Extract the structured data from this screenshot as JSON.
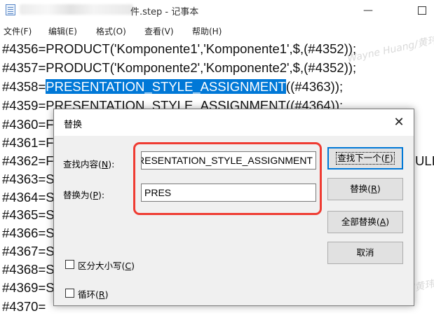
{
  "window": {
    "title_suffix": "件.step - 记事本",
    "minimize_glyph": "—"
  },
  "menu": [
    {
      "label": "文件(F)"
    },
    {
      "label": "编辑(E)"
    },
    {
      "label": "格式(O)"
    },
    {
      "label": "查看(V)"
    },
    {
      "label": "帮助(H)"
    }
  ],
  "editor": {
    "lines": [
      "#4356=PRODUCT('Komponente1','Komponente1',$,(#4352));",
      "#4357=PRODUCT('Komponente2','Komponente2',$,(#4352));",
      "#4358=",
      "#4359=PRESENTATION_STYLE_ASSIGNMENT((#4364));",
      "#4360=F",
      "#4361=F",
      "#4362=F",
      "#4363=S",
      "#4364=S",
      "#4365=S",
      "#4366=S",
      "#4367=S",
      "#4368=S",
      "#4369=S",
      "#4370="
    ],
    "highlighted_text": "PRESENTATION_STYLE_ASSIGNMENT",
    "line3_rest": "((#4363));",
    "right_peek_text": "ULI",
    "watermark": "Wayne Huang/黄玮"
  },
  "dialog": {
    "title": "替换",
    "close_glyph": "✕",
    "find_label": "查找内容(",
    "find_label_key": "N",
    "find_label_end": "):",
    "replace_label": "替换为(",
    "replace_label_key": "P",
    "replace_label_end": "):",
    "find_value": "PRESENTATION_STYLE_ASSIGNMENT",
    "replace_value": "PRES",
    "buttons": {
      "find_next": "查找下一个(",
      "find_next_key": "F",
      "find_next_end": ")",
      "replace": "替换(",
      "replace_key": "R",
      "replace_end": ")",
      "replace_all": "全部替换(",
      "replace_all_key": "A",
      "replace_all_end": ")",
      "cancel": "取消"
    },
    "options": {
      "match_case": "区分大小写(",
      "match_case_key": "C",
      "match_case_end": ")",
      "wrap": "循环(",
      "wrap_key": "R",
      "wrap_end": ")"
    }
  },
  "colors": {
    "selection": "#0078d7",
    "highlight_box": "#ef3b32",
    "dialog_bg": "#f0f0f0"
  }
}
